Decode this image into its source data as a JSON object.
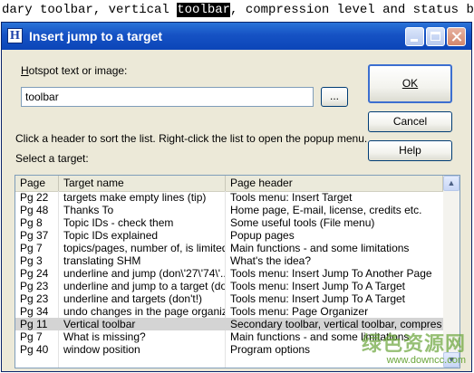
{
  "background_line": {
    "before": "dary toolbar, vertical ",
    "highlight": "toolbar",
    "after": ", compression level and status bar"
  },
  "window": {
    "title": "Insert jump to a target",
    "icon": "H",
    "controls": [
      "minimize",
      "maximize",
      "close"
    ]
  },
  "form": {
    "hotspot_label": "Hotspot text or image:",
    "hotspot_value": "toolbar",
    "browse_label": "...",
    "instructions": "Click a header to sort the list. Right-click the list to open the popup menu.",
    "select_label": "Select a target:"
  },
  "buttons": {
    "ok": "OK",
    "cancel": "Cancel",
    "help": "Help"
  },
  "list": {
    "columns": [
      "Page",
      "Target name",
      "Page header"
    ],
    "rows": [
      {
        "page": "Pg 22",
        "target": "targets make empty lines (tip)",
        "header": "Tools menu: Insert Target"
      },
      {
        "page": "Pg 48",
        "target": "Thanks To",
        "header": "Home page, E-mail, license, credits etc."
      },
      {
        "page": "Pg 8",
        "target": "Topic IDs - check them",
        "header": "Some useful tools (File menu)"
      },
      {
        "page": "Pg 37",
        "target": "Topic IDs explained",
        "header": "Popup pages"
      },
      {
        "page": "Pg 7",
        "target": "topics/pages, number of, is limited",
        "header": "Main functions - and some limitations"
      },
      {
        "page": "Pg 3",
        "target": "translating SHM",
        "header": "What's the idea?"
      },
      {
        "page": "Pg 24",
        "target": "underline and jump (don\\'27\\'74\\'...",
        "header": "Tools menu: Insert Jump To Another Page"
      },
      {
        "page": "Pg 23",
        "target": "underline and jump to a target (do...",
        "header": "Tools menu: Insert Jump To A Target"
      },
      {
        "page": "Pg 23",
        "target": "underline and targets (don't!)",
        "header": "Tools menu: Insert Jump To A Target"
      },
      {
        "page": "Pg 34",
        "target": "undo changes in the page organizer",
        "header": "Tools menu: Page Organizer"
      },
      {
        "page": "Pg 11",
        "target": "Vertical toolbar",
        "header": "Secondary toolbar, vertical toolbar, compres...",
        "selected": true
      },
      {
        "page": "Pg 7",
        "target": "What is missing?",
        "header": "Main functions - and some limitations"
      },
      {
        "page": "Pg 40",
        "target": "window position",
        "header": "Program options"
      }
    ]
  },
  "watermark": {
    "line1": "绿色资源网",
    "line2": "www.downcc.com"
  }
}
